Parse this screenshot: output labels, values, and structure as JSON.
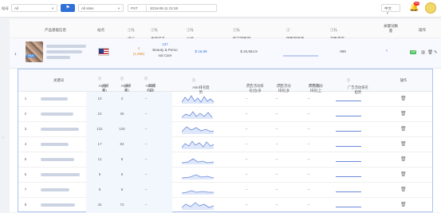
{
  "toolbar": {
    "label": "站号",
    "shop_select": "All",
    "site_select": "All sites",
    "timezone": "PST",
    "date": "2018-08-11 01:50",
    "language": "中文",
    "badge": "10"
  },
  "product_table": {
    "headers": {
      "product_info": "产品基础信息",
      "site": "站点",
      "rating": "评分",
      "category_rank": "类目排名",
      "price": "价格",
      "sales_amount": "昨日销售额",
      "sales_trend": "销售额趋势",
      "stock": "可售库存",
      "keywords": "关键词数量",
      "actions": "操作"
    },
    "row": {
      "index": "1",
      "badge": "FBA",
      "rating": "4",
      "rating_count": "(1,696)",
      "rank": "137",
      "category_line1": "Beauty & Perso",
      "category_line2": "nal Care",
      "price": "$ 16.99",
      "sales": "$ 25,954.9",
      "stock": "999",
      "green_tag": "关键",
      "expand": "‹"
    }
  },
  "keyword_table": {
    "headers": {
      "keyword": "关键词",
      "asin_rank": "Asin排名",
      "asin_rank_unit": "(位/页)",
      "asin_rank_page": "Asin排名",
      "asin_rank_page_unit": "(多/页)",
      "asin_rank_prev": "Asin排名(上",
      "asin_rank_prev_unit": "周同日)",
      "asin_trend": "Asin排名趋势",
      "ad_rank": "广告活动排名(位/多",
      "ad_rank_unit": "页)",
      "ad_rank_page": "广告活动排名(多",
      "ad_rank_page_unit": "/页)",
      "ad_rank_prev": "广告活动排名(上",
      "ad_rank_prev_unit": "周同日)",
      "ad_trend": "广告活动排名趋势",
      "actions": "操作"
    },
    "rows": [
      {
        "index": "1",
        "rank": "10",
        "page": "3",
        "prev": "--",
        "ad1": "--",
        "ad2": "--",
        "ad3": "--"
      },
      {
        "index": "2",
        "rank": "24",
        "page": "26",
        "prev": "--",
        "ad1": "--",
        "ad2": "--",
        "ad3": "--"
      },
      {
        "index": "3",
        "rank": "131",
        "page": "126",
        "prev": "--",
        "ad1": "--",
        "ad2": "--",
        "ad3": "--"
      },
      {
        "index": "4",
        "rank": "17",
        "page": "84",
        "prev": "--",
        "ad1": "--",
        "ad2": "--",
        "ad3": "--"
      },
      {
        "index": "5",
        "rank": "11",
        "page": "8",
        "prev": "--",
        "ad1": "--",
        "ad2": "--",
        "ad3": "--"
      },
      {
        "index": "6",
        "rank": "6",
        "page": "6",
        "prev": "--",
        "ad1": "--",
        "ad2": "--",
        "ad3": "--"
      },
      {
        "index": "7",
        "rank": "8",
        "page": "9",
        "prev": "--",
        "ad1": "--",
        "ad2": "--",
        "ad3": "--"
      },
      {
        "index": "8",
        "rank": "34",
        "page": "72",
        "prev": "--",
        "ad1": "--",
        "ad2": "--",
        "ad3": "--"
      }
    ]
  },
  "colors": {
    "accent": "#3b73d6",
    "sub_border": "#a8c4f0",
    "rating": "#e28a1f",
    "fba": "#4a8fe0"
  }
}
